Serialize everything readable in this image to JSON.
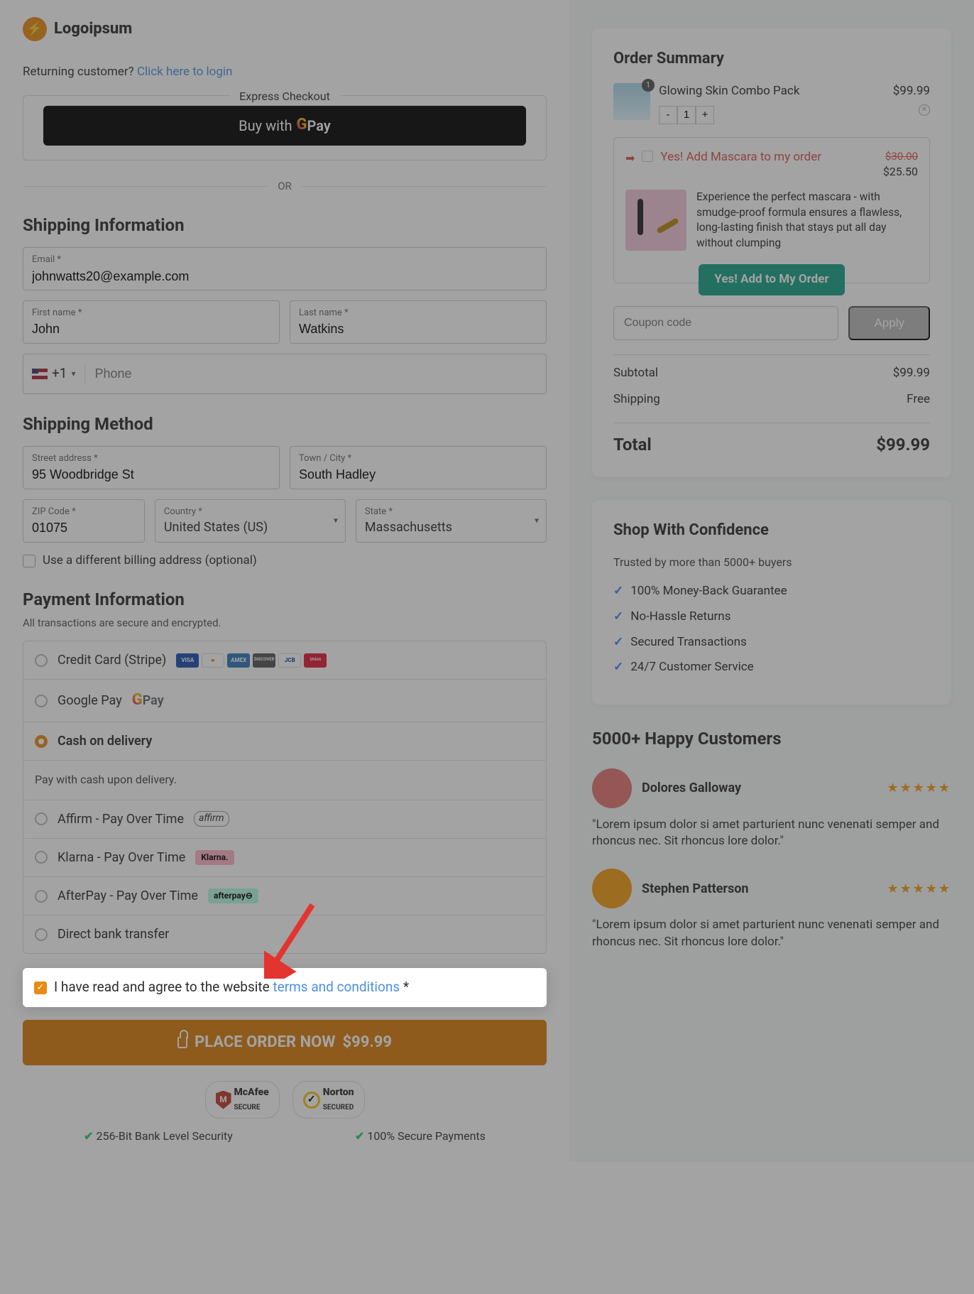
{
  "brand": {
    "name": "Logoipsum"
  },
  "returning": {
    "text": "Returning customer? ",
    "link": "Click here to login"
  },
  "express": {
    "label": "Express Checkout",
    "gpay_prefix": "Buy with ",
    "gpay_suffix": " Pay"
  },
  "or": "OR",
  "shipping_info": {
    "title": "Shipping Information",
    "email_lbl": "Email *",
    "email_val": "johnwatts20@example.com",
    "first_lbl": "First name *",
    "first_val": "John",
    "last_lbl": "Last name *",
    "last_val": "Watkins",
    "phone_prefix": "+1",
    "phone_placeholder": "Phone"
  },
  "shipping_method": {
    "title": "Shipping Method",
    "street_lbl": "Street address *",
    "street_val": "95 Woodbridge St",
    "city_lbl": "Town / City *",
    "city_val": "South Hadley",
    "zip_lbl": "ZIP Code *",
    "zip_val": "01075",
    "country_lbl": "Country *",
    "country_val": "United States (US)",
    "state_lbl": "State *",
    "state_val": "Massachusetts",
    "diff_addr": "Use a different billing address (optional)"
  },
  "payment": {
    "title": "Payment Information",
    "sub": "All transactions are secure and encrypted.",
    "cc": "Credit Card (Stripe)",
    "gpay": "Google Pay",
    "gpay_suffix": " Pay",
    "cod": "Cash on delivery",
    "cod_note": "Pay with cash upon delivery.",
    "affirm": "Affirm - Pay Over Time",
    "affirm_logo": "affirm",
    "klarna": "Klarna - Pay Over Time",
    "klarna_logo": "Klarna.",
    "afterpay": "AfterPay - Pay Over Time",
    "afterpay_logo": "afterpay⊖",
    "bank": "Direct bank transfer"
  },
  "terms": {
    "pre": "I have read and agree to the website ",
    "link": "terms and conditions",
    "post": " *"
  },
  "place_order": {
    "label": "PLACE ORDER NOW",
    "price": "$99.99"
  },
  "seals": {
    "mcafee_l1": "McAfee",
    "mcafee_l2": "SECURE",
    "norton_l1": "Norton",
    "norton_l2": "SECURED"
  },
  "bullets": {
    "a": "256-Bit Bank Level Security",
    "b": "100% Secure Payments"
  },
  "order": {
    "title": "Order Summary",
    "item": {
      "name": "Glowing Skin Combo Pack",
      "price": "$99.99",
      "qty": "1",
      "badge": "1"
    },
    "upsell": {
      "title": "Yes! Add Mascara to my order",
      "old": "$30.00",
      "new": "$25.50",
      "desc": "Experience the perfect mascara - with smudge-proof formula ensures a flawless, long-lasting finish that stays put all day without clumping",
      "btn": "Yes! Add to My Order"
    },
    "coupon_placeholder": "Coupon code",
    "apply": "Apply",
    "subtotal_lbl": "Subtotal",
    "subtotal": "$99.99",
    "shipping_lbl": "Shipping",
    "shipping": "Free",
    "total_lbl": "Total",
    "total": "$99.99"
  },
  "confidence": {
    "title": "Shop With Confidence",
    "sub": "Trusted by more than 5000+ buyers",
    "items": [
      "100% Money-Back Guarantee",
      "No-Hassle Returns",
      "Secured Transactions",
      "24/7 Customer Service"
    ]
  },
  "reviews": {
    "title": "5000+ Happy Customers",
    "list": [
      {
        "name": "Dolores Galloway",
        "text": "\"Lorem ipsum dolor si amet parturient nunc venenati semper and rhoncus nec. Sit rhoncus lore dolor.\"",
        "avatar_bg": "#e57373"
      },
      {
        "name": "Stephen Patterson",
        "text": "\"Lorem ipsum dolor si amet parturient nunc venenati semper and rhoncus nec. Sit rhoncus lore dolor.\"",
        "avatar_bg": "#f39c12"
      }
    ]
  }
}
